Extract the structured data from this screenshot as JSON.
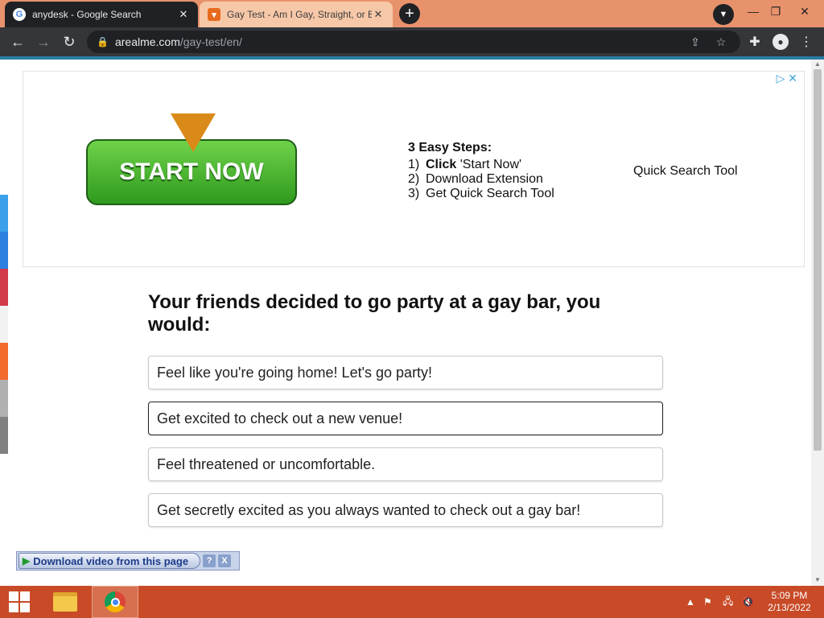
{
  "browser": {
    "tabs": [
      {
        "title": "anydesk - Google Search",
        "favicon": "google-g-icon",
        "active": false
      },
      {
        "title": "Gay Test - Am I Gay, Straight, or B",
        "favicon": "fox-icon",
        "active": true
      }
    ],
    "close_glyph": "✕",
    "new_tab_glyph": "+",
    "url_host": "arealme.com",
    "url_path": "/gay-test/en/"
  },
  "ad": {
    "start_label": "START NOW",
    "steps_title": "3 Easy Steps:",
    "steps": [
      {
        "num": "1)",
        "bold": "Click",
        "text": " 'Start Now'"
      },
      {
        "num": "2)",
        "bold": "",
        "text": "Download Extension"
      },
      {
        "num": "3)",
        "bold": "",
        "text": "Get Quick Search Tool"
      }
    ],
    "side_text": "Quick Search Tool",
    "ad_choices": "▷ ✕"
  },
  "quiz": {
    "question": "Your friends decided to go party at a gay bar, you would:",
    "answers": [
      "Feel like you're going home! Let's go party!",
      "Get excited to check out a new venue!",
      "Feel threatened or uncomfortable.",
      "Get secretly excited as you always wanted to check out a gay bar!"
    ],
    "selected_index": 1
  },
  "download_bar": {
    "label": "Download video from this page",
    "help": "?",
    "close": "X"
  },
  "share_rail_colors": [
    "#3aa0e8",
    "#2d7fe0",
    "#d23a4a",
    "#f2f2f2",
    "#f26a2e",
    "#b0b0b0",
    "#808080"
  ],
  "taskbar": {
    "time": "5:09 PM",
    "date": "2/13/2022"
  },
  "colors": {
    "tabstrip": "#e8926c",
    "toolbar": "#35363a",
    "taskbar": "#c84a26",
    "start_button": "#3fae25"
  }
}
